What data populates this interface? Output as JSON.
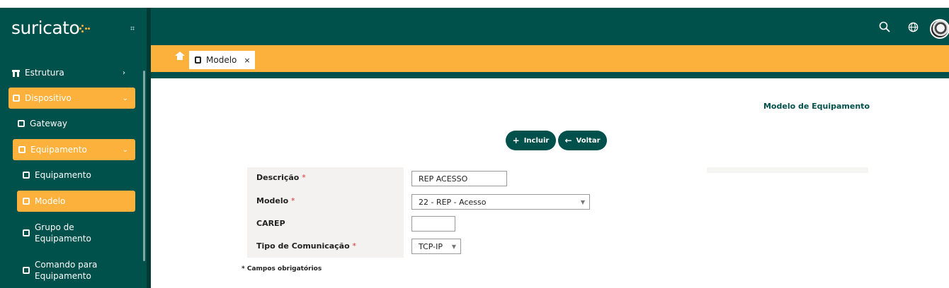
{
  "brand": {
    "name": "suricato"
  },
  "sidebar": {
    "items": [
      {
        "label": "Estrutura",
        "icon": "structure-icon"
      },
      {
        "label": "Dispositivo",
        "icon": "device-icon"
      },
      {
        "label": "Gateway",
        "icon": "device-icon"
      },
      {
        "label": "Equipamento",
        "icon": "device-icon"
      },
      {
        "label": "Equipamento",
        "icon": "device-icon"
      },
      {
        "label": "Modelo",
        "icon": "device-icon"
      },
      {
        "label": "Grupo de Equipamento",
        "line1": "Grupo de",
        "line2": "Equipamento",
        "icon": "device-icon"
      },
      {
        "label": "Comando para Equipamento",
        "line1": "Comando para",
        "line2": "Equipamento",
        "icon": "device-icon"
      }
    ]
  },
  "tabs": [
    {
      "label": "Modelo",
      "close": "×"
    }
  ],
  "page": {
    "heading": "Modelo de Equipamento",
    "buttons": {
      "add": "Incluir",
      "back": "Voltar"
    }
  },
  "form": {
    "descricao": {
      "label": "Descrição",
      "value": "REP ACESSO",
      "required": "*"
    },
    "modelo": {
      "label": "Modelo",
      "value": "22 - REP - Acesso",
      "required": "*"
    },
    "carep": {
      "label": "CAREP",
      "value": ""
    },
    "tipo": {
      "label": "Tipo de Comunicação",
      "value": "TCP-IP",
      "required": "*"
    },
    "note": "* Campos obrigatórios"
  },
  "colors": {
    "primary": "#00504b",
    "accent": "#fbb13c"
  }
}
